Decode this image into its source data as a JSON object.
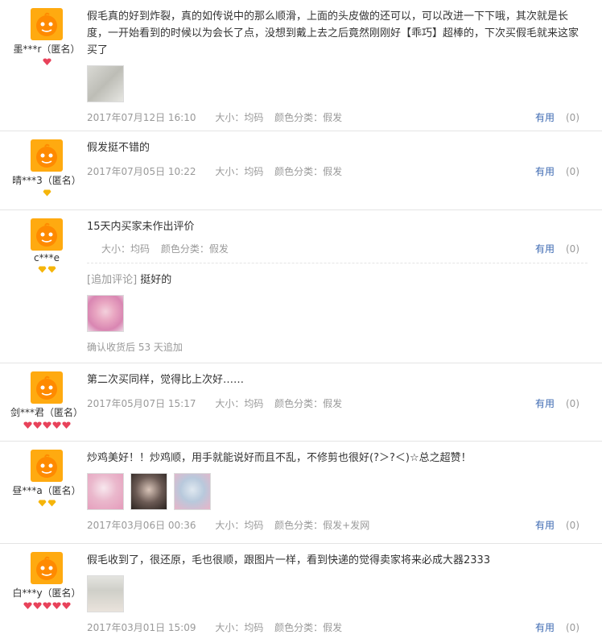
{
  "reviews": [
    {
      "user": "墨***r（匿名）",
      "badge_count": 1,
      "text": "假毛真的好到炸裂，真的如传说中的那么顺滑，上面的头皮做的还可以，可以改进一下下哦，其次就是长度，一开始看到的时候以为会长了点，没想到戴上去之后竟然刚刚好【乖巧】超棒的，下次买假毛就来这家买了",
      "pics": 1,
      "date": "2017年07月12日 16:10",
      "size": "大小：均码",
      "color": "颜色分类：假发",
      "useful": "有用",
      "count": "(0)"
    },
    {
      "user": "晴***3（匿名）",
      "badge_count": 1,
      "text": "假发挺不错的",
      "pics": 0,
      "date": "2017年07月05日 10:22",
      "size": "大小：均码",
      "color": "颜色分类：假发",
      "useful": "有用",
      "count": "(0)"
    },
    {
      "user": "c***e",
      "badge_count": 2,
      "text": "15天内买家未作出评价",
      "pics": 0,
      "date": "",
      "size": "大小：均码",
      "color": "颜色分类：假发",
      "useful": "有用",
      "count": "(0)",
      "append_tag": "[追加评论]",
      "append_text": "挺好的",
      "append_pics": 1,
      "append_meta": "确认收货后 53 天追加"
    },
    {
      "user": "剑***君（匿名）",
      "badge_count": 5,
      "text": "第二次买同样，觉得比上次好……",
      "pics": 0,
      "date": "2017年05月07日 15:17",
      "size": "大小：均码",
      "color": "颜色分类：假发",
      "useful": "有用",
      "count": "(0)"
    },
    {
      "user": "昼***a（匿名）",
      "badge_count": 2,
      "text": "炒鸡美好！！炒鸡顺，用手就能说好而且不乱，不修剪也很好(?＞?＜)☆总之超赞！",
      "pics": 3,
      "date": "2017年03月06日 00:36",
      "size": "大小：均码",
      "color": "颜色分类：假发+发网",
      "useful": "有用",
      "count": "(0)"
    },
    {
      "user": "白***y（匿名）",
      "badge_count": 5,
      "text": "假毛收到了，很还原，毛也很顺，跟图片一样，看到快递的觉得卖家将来必成大器2333",
      "pics": 1,
      "date": "2017年03月01日 15:09",
      "size": "大小：均码",
      "color": "颜色分类：假发",
      "useful": "有用",
      "count": "(0)"
    }
  ],
  "colors": {
    "avatar": "#ffaa10",
    "link": "#3c69b2",
    "muted": "#999999",
    "badge_red": "#e8425a",
    "badge_gold": "#f5b50a"
  }
}
